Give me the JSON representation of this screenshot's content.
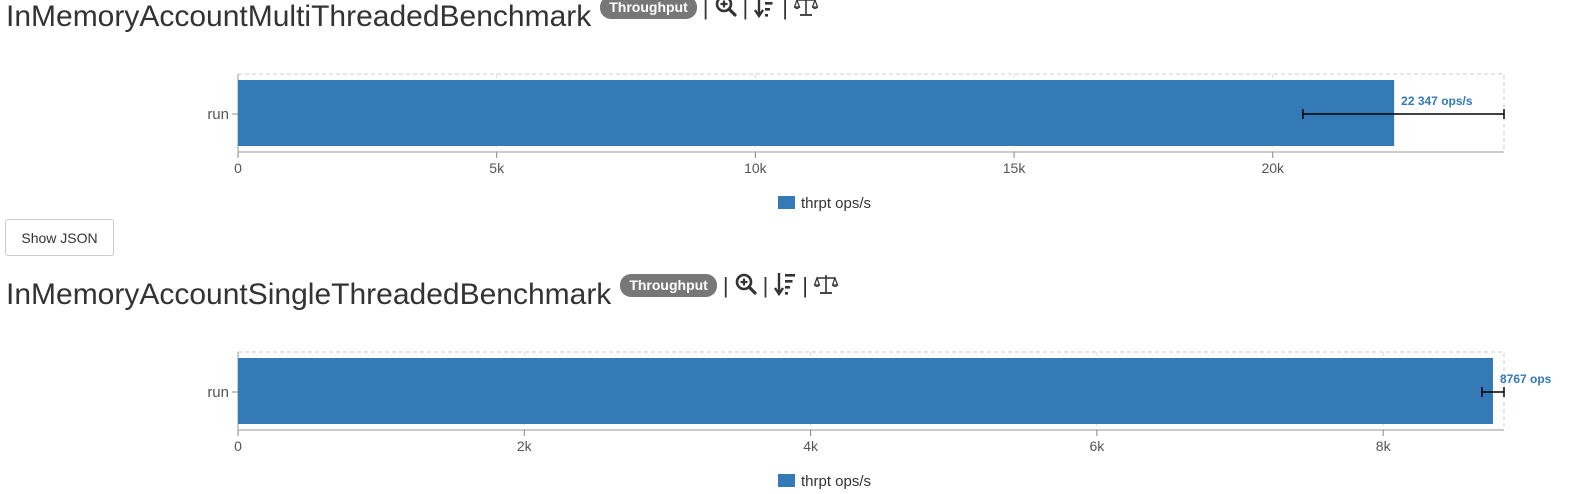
{
  "colors": {
    "bar": "#337ab7",
    "badge": "#777777",
    "error_bar": "#000000",
    "grid": "#cccccc"
  },
  "icons": [
    "zoom-in-icon",
    "sort-desc-icon",
    "balance-scale-icon"
  ],
  "show_json_label": "Show JSON",
  "benchmarks": [
    {
      "title": "InMemoryAccountMultiThreadedBenchmark",
      "mode_badge": "Throughput",
      "legend_label": "thrpt ops/s"
    },
    {
      "title": "InMemoryAccountSingleThreadedBenchmark",
      "mode_badge": "Throughput",
      "legend_label": "thrpt ops/s"
    }
  ],
  "chart_data": [
    {
      "type": "bar",
      "orientation": "horizontal",
      "categories": [
        "run"
      ],
      "series": [
        {
          "name": "thrpt ops/s",
          "values": [
            22347
          ]
        }
      ],
      "error_bars": [
        {
          "low": 20582,
          "high": 24470
        }
      ],
      "data_labels": [
        "22 347 ops/s"
      ],
      "x_ticks": [
        0,
        5000,
        10000,
        15000,
        20000
      ],
      "x_tick_labels": [
        "0",
        "5k",
        "10k",
        "15k",
        "20k"
      ],
      "xlim": [
        0,
        24470
      ],
      "grid": true,
      "legend_position": "bottom"
    },
    {
      "type": "bar",
      "orientation": "horizontal",
      "categories": [
        "run"
      ],
      "series": [
        {
          "name": "thrpt ops/s",
          "values": [
            8767
          ]
        }
      ],
      "error_bars": [
        {
          "low": 8690,
          "high": 8844
        }
      ],
      "data_labels": [
        "8767 ops"
      ],
      "x_ticks": [
        0,
        2000,
        4000,
        6000,
        8000
      ],
      "x_tick_labels": [
        "0",
        "2k",
        "4k",
        "6k",
        "8k"
      ],
      "xlim": [
        0,
        8844
      ],
      "grid": true,
      "legend_position": "bottom"
    }
  ]
}
